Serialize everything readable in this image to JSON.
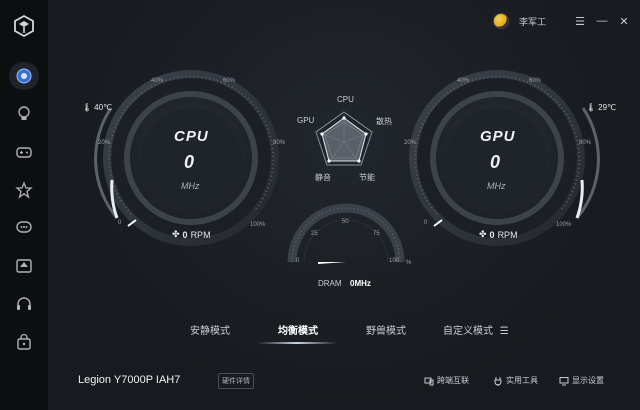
{
  "sidebar": {
    "items": [
      {
        "icon": "dashboard-icon"
      },
      {
        "icon": "lightbulb-icon"
      },
      {
        "icon": "gamepad-icon"
      },
      {
        "icon": "star-icon"
      },
      {
        "icon": "chat-icon"
      },
      {
        "icon": "upload-icon"
      },
      {
        "icon": "headset-icon"
      },
      {
        "icon": "bag-icon"
      }
    ]
  },
  "topbar": {
    "username": "李军工"
  },
  "cpu": {
    "title": "CPU",
    "value": "0",
    "unit": "MHz",
    "temp": "40℃",
    "rpm_value": "0",
    "rpm_unit": "RPM"
  },
  "gpu": {
    "title": "GPU",
    "value": "0",
    "unit": "MHz",
    "temp": "29℃",
    "rpm_value": "0",
    "rpm_unit": "RPM"
  },
  "ticks": {
    "t0": "0",
    "t20": "20%",
    "t40": "40%",
    "t60": "60%",
    "t80": "80%",
    "t100": "100%"
  },
  "radar": {
    "top": "CPU",
    "right": "散热",
    "bottom_right": "节能",
    "bottom_left": "静音",
    "left": "GPU"
  },
  "dram": {
    "label": "DRAM",
    "value": "0MHz",
    "t0": "0",
    "t25": "25",
    "t50": "50",
    "t75": "75",
    "t100": "100",
    "pct": "%"
  },
  "modes": {
    "quiet": "安静模式",
    "balanced": "均衡模式",
    "beast": "野兽模式",
    "custom": "自定义模式",
    "active": "balanced"
  },
  "bottom": {
    "device": "Legion Y7000P IAH7",
    "hw_details": "硬件详情",
    "cross": "跨端互联",
    "tools": "实用工具",
    "display": "显示设置"
  },
  "colors": {
    "accent": "#ffffff",
    "bg": "#171a1e",
    "sidebar": "#0c0e10"
  }
}
